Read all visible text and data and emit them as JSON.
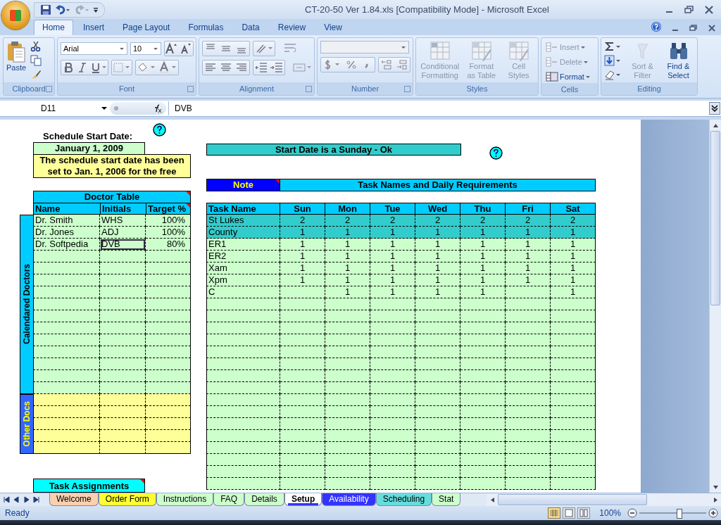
{
  "title_bar": {
    "title": "CT-20-50 Ver 1.84.xls  [Compatibility Mode] - Microsoft Excel"
  },
  "ribbon_tabs": [
    {
      "label": "Home",
      "selected": true
    },
    {
      "label": "Insert",
      "selected": false
    },
    {
      "label": "Page Layout",
      "selected": false
    },
    {
      "label": "Formulas",
      "selected": false
    },
    {
      "label": "Data",
      "selected": false
    },
    {
      "label": "Review",
      "selected": false
    },
    {
      "label": "View",
      "selected": false
    }
  ],
  "ribbon": {
    "clipboard": {
      "paste": "Paste",
      "label": "Clipboard"
    },
    "font": {
      "name": "Arial",
      "size": "10",
      "label": "Font"
    },
    "alignment": {
      "label": "Alignment"
    },
    "number": {
      "label": "Number"
    },
    "styles": {
      "label": "Styles",
      "buttons": [
        {
          "label": "Conditional Formatting",
          "disabled": true
        },
        {
          "label": "Format as Table",
          "disabled": true
        },
        {
          "label": "Cell Styles",
          "disabled": true
        }
      ]
    },
    "cells": {
      "label": "Cells",
      "buttons": [
        {
          "label": "Insert",
          "disabled": true
        },
        {
          "label": "Delete",
          "disabled": true
        },
        {
          "label": "Format",
          "disabled": false
        }
      ]
    },
    "editing": {
      "label": "Editing",
      "buttons": [
        {
          "label": "Sort & Filter",
          "disabled": true
        },
        {
          "label": "Find & Select",
          "disabled": false
        }
      ]
    }
  },
  "formula_bar": {
    "cell": "D11",
    "value": "DVB"
  },
  "sheet": {
    "start_label": "Schedule Start Date:",
    "start_date": "January 1, 2009",
    "date_note": "The schedule start date has been set to Jan. 1, 2006 for the free",
    "start_check": "Start Date is a Sunday - Ok",
    "doctor_table": {
      "title": "Doctor Table",
      "columns": [
        "Name",
        "Initials",
        "Target %"
      ],
      "group_labels": [
        "Calendared Doctors",
        "Other Docs"
      ],
      "rows": [
        {
          "name": "Dr. Smith",
          "initials": "WHS",
          "target": "100%",
          "selected": false
        },
        {
          "name": "Dr. Jones",
          "initials": "ADJ",
          "target": "100%",
          "selected": false
        },
        {
          "name": "Dr. Softpedia",
          "initials": "DVB",
          "target": "80%",
          "selected": true
        }
      ]
    },
    "task_assignments": "Task Assignments",
    "note": "Note",
    "task_table": {
      "title": "Task Names and Daily Requirements",
      "columns": [
        "Task Name",
        "Sun",
        "Mon",
        "Tue",
        "Wed",
        "Thu",
        "Fri",
        "Sat"
      ],
      "rows": [
        {
          "name": "St Lukes",
          "highlighted": true,
          "values": {
            "sun": "2",
            "mon": "2",
            "tue": "2",
            "wed": "2",
            "thu": "2",
            "fri": "2",
            "sat": "2"
          }
        },
        {
          "name": "County",
          "highlighted": true,
          "values": {
            "sun": "1",
            "mon": "1",
            "tue": "1",
            "wed": "1",
            "thu": "1",
            "fri": "1",
            "sat": "1"
          }
        },
        {
          "name": "ER1",
          "highlighted": false,
          "values": {
            "sun": "1",
            "mon": "1",
            "tue": "1",
            "wed": "1",
            "thu": "1",
            "fri": "1",
            "sat": "1"
          }
        },
        {
          "name": "ER2",
          "highlighted": false,
          "values": {
            "sun": "1",
            "mon": "1",
            "tue": "1",
            "wed": "1",
            "thu": "1",
            "fri": "1",
            "sat": "1"
          }
        },
        {
          "name": "Xam",
          "highlighted": false,
          "values": {
            "sun": "1",
            "mon": "1",
            "tue": "1",
            "wed": "1",
            "thu": "1",
            "fri": "1",
            "sat": "1"
          }
        },
        {
          "name": "Xpm",
          "highlighted": false,
          "values": {
            "sun": "1",
            "mon": "1",
            "tue": "1",
            "wed": "1",
            "thu": "1",
            "fri": "1",
            "sat": "1"
          }
        },
        {
          "name": "C",
          "highlighted": false,
          "values": {
            "mon": "1",
            "tue": "1",
            "wed": "1",
            "thu": "1",
            "sat": "1"
          }
        }
      ]
    }
  },
  "sheet_tabs": [
    {
      "label": "Welcome",
      "selected": false,
      "color": "#fad0b0"
    },
    {
      "label": "Order Form",
      "selected": false,
      "color": "#ffff33"
    },
    {
      "label": "Instructions",
      "selected": false,
      "color": "#ccffcc"
    },
    {
      "label": "FAQ",
      "selected": false,
      "color": "#ccffcc"
    },
    {
      "label": "Details",
      "selected": false,
      "color": "#ccffcc"
    },
    {
      "label": "Setup",
      "selected": true,
      "color": "#3333ff"
    },
    {
      "label": "Availability",
      "selected": false,
      "color": "#3333ff"
    },
    {
      "label": "Scheduling",
      "selected": false,
      "color": "#66dddd"
    },
    {
      "label": "Stat",
      "selected": false,
      "color": "#ccffcc"
    }
  ],
  "status_bar": {
    "status": "Ready",
    "zoom": "100%",
    "zoom_slider": {
      "level": 0.6
    }
  }
}
